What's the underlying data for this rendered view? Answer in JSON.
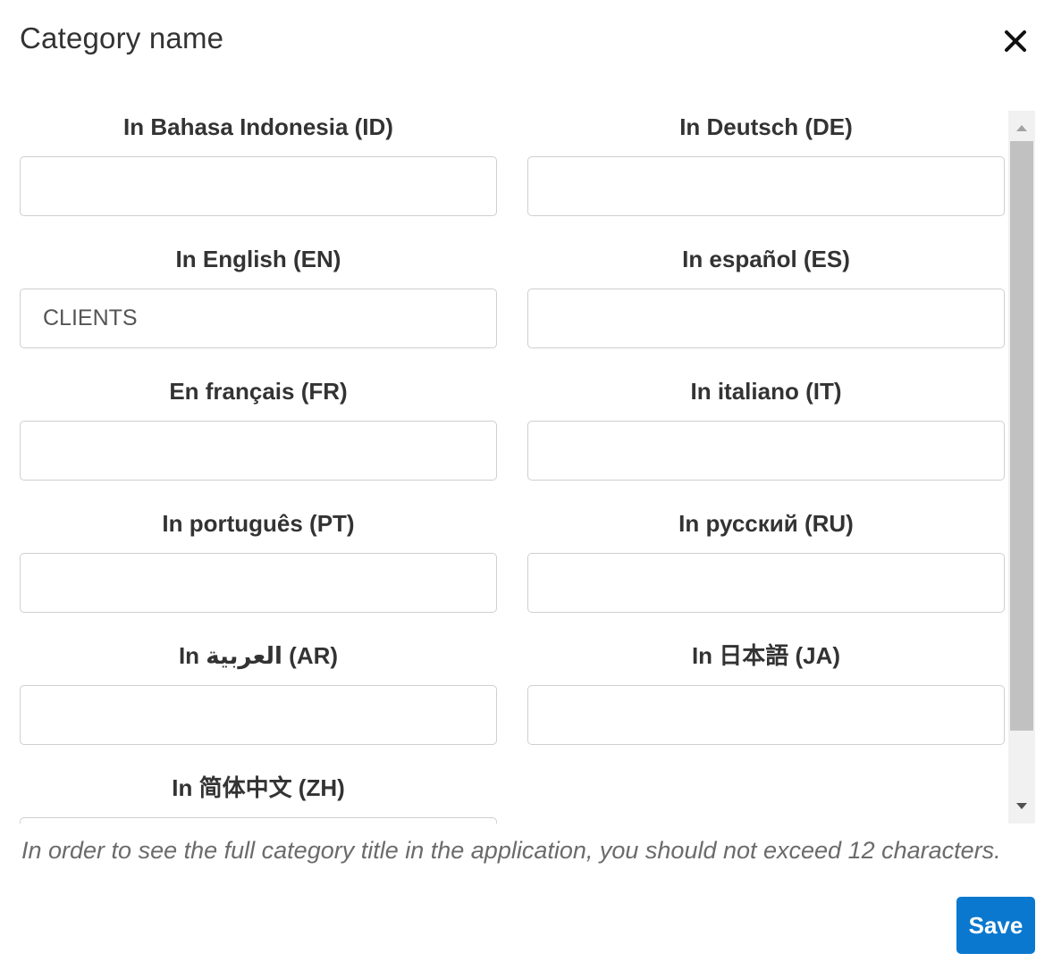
{
  "dialog": {
    "title": "Category name",
    "close_icon": "close-icon",
    "hint": "In order to see the full category title in the application, you should not exceed 12 characters.",
    "save_label": "Save"
  },
  "fields": [
    {
      "label": "In Bahasa Indonesia (ID)",
      "value": ""
    },
    {
      "label": "In Deutsch (DE)",
      "value": ""
    },
    {
      "label": "In English (EN)",
      "value": "CLIENTS"
    },
    {
      "label": "In español (ES)",
      "value": ""
    },
    {
      "label": "En français (FR)",
      "value": ""
    },
    {
      "label": "In italiano (IT)",
      "value": ""
    },
    {
      "label": "In português (PT)",
      "value": ""
    },
    {
      "label": "In русский (RU)",
      "value": ""
    },
    {
      "label": "In العربية (AR)",
      "value": ""
    },
    {
      "label": "In 日本語 (JA)",
      "value": ""
    },
    {
      "label": "In 简体中文 (ZH)",
      "value": ""
    }
  ],
  "colors": {
    "primary": "#0a78cf",
    "text": "#333333",
    "hint": "#6b6b6b",
    "border": "#cfcfcf"
  }
}
